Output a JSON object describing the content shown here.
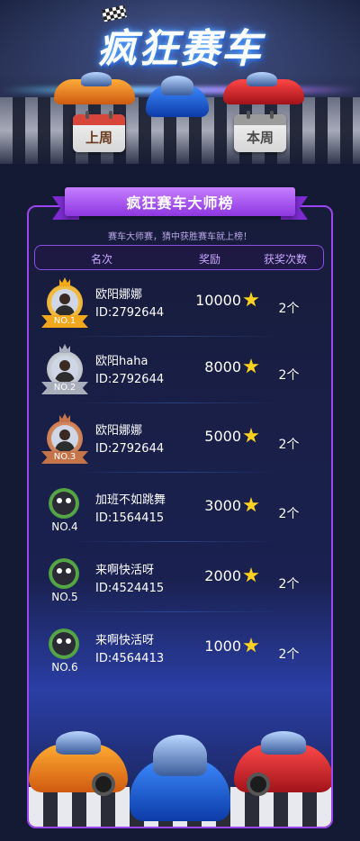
{
  "header": {
    "title": "疯狂赛车",
    "last_week_label": "上周",
    "this_week_label": "本周"
  },
  "board": {
    "title": "疯狂赛车大师榜",
    "subtitle": "赛车大师赛，猜中获胜赛车就上榜！",
    "columns": [
      "名次",
      "奖励",
      "获奖次数"
    ]
  },
  "rows": [
    {
      "rank": "NO.1",
      "name": "欧阳娜娜",
      "id": "ID:2792644",
      "reward": "10000",
      "count": "2个",
      "medal": "gold"
    },
    {
      "rank": "NO.2",
      "name": "欧阳haha",
      "id": "ID:2792644",
      "reward": "8000",
      "count": "2个",
      "medal": "silver"
    },
    {
      "rank": "NO.3",
      "name": "欧阳娜娜",
      "id": "ID:2792644",
      "reward": "5000",
      "count": "2个",
      "medal": "bronze"
    },
    {
      "rank": "NO.4",
      "name": "加班不如跳舞",
      "id": "ID:1564415",
      "reward": "3000",
      "count": "2个",
      "medal": "plain"
    },
    {
      "rank": "NO.5",
      "name": "来啊快活呀",
      "id": "ID:4524415",
      "reward": "2000",
      "count": "2个",
      "medal": "plain"
    },
    {
      "rank": "NO.6",
      "name": "来啊快活呀",
      "id": "ID:4564413",
      "reward": "1000",
      "count": "2个",
      "medal": "plain"
    }
  ],
  "colors": {
    "accent_purple": "#9b46f0",
    "ribbon": "#a24bf0",
    "star": "#ffd21f",
    "background": "#141a33"
  },
  "icons": [
    "checkered-flag-icon",
    "calendar-icon",
    "star-icon",
    "avatar",
    "race-car"
  ]
}
